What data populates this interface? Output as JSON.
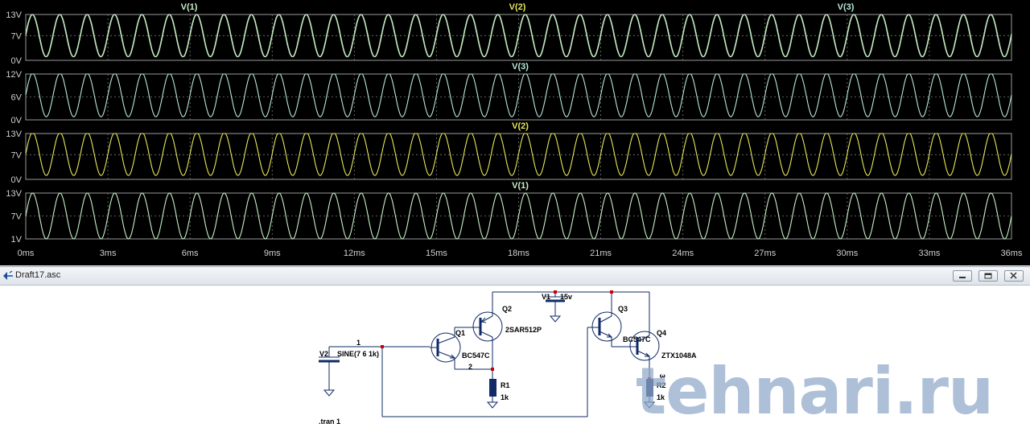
{
  "plot": {
    "panes": [
      {
        "traces": [
          {
            "label": "V(1)",
            "color": "#c8f0c8"
          },
          {
            "label": "V(2)",
            "color": "#e8e85a"
          },
          {
            "label": "V(3)",
            "color": "#b8e8d8"
          }
        ],
        "y_ticks": [
          "13V",
          "7V",
          "0V"
        ],
        "y_range": [
          0,
          13
        ],
        "signal": {
          "offset": 7,
          "amplitude": 6
        }
      },
      {
        "traces": [
          {
            "label": "V(3)",
            "color": "#b8e8d8"
          }
        ],
        "y_ticks": [
          "12V",
          "6V",
          "0V"
        ],
        "y_range": [
          0,
          12
        ],
        "signal": {
          "offset": 6.5,
          "amplitude": 5.7
        }
      },
      {
        "traces": [
          {
            "label": "V(2)",
            "color": "#e8e85a"
          }
        ],
        "y_ticks": [
          "13V",
          "7V",
          "0V"
        ],
        "y_range": [
          0,
          13
        ],
        "signal": {
          "offset": 7.2,
          "amplitude": 6.1
        }
      },
      {
        "traces": [
          {
            "label": "V(1)",
            "color": "#c8f0c8"
          }
        ],
        "y_ticks": [
          "13V",
          "7V",
          "1V"
        ],
        "y_range": [
          1,
          13
        ],
        "signal": {
          "offset": 7,
          "amplitude": 6
        }
      }
    ],
    "x_ticks": [
      "0ms",
      "3ms",
      "6ms",
      "9ms",
      "12ms",
      "15ms",
      "18ms",
      "21ms",
      "24ms",
      "27ms",
      "30ms",
      "33ms",
      "36ms"
    ],
    "x_range_ms": [
      0,
      36
    ],
    "signal_frequency_hz": 1000,
    "grid_color": "#7a7a7a",
    "axis_text_color": "#cfcfcf"
  },
  "schematic_window": {
    "title": "Draft17.asc",
    "icon": "ltspice-schematic-icon",
    "buttons": {
      "minimize": "minimize-icon",
      "restore": "restore-icon",
      "close": "close-icon"
    }
  },
  "schematic": {
    "net_labels": {
      "n1": "1",
      "n2": "2",
      "n3": "3"
    },
    "v2": {
      "name": "V2",
      "value": "SINE(7 6 1k)"
    },
    "v1": {
      "name": "V1",
      "value": "15v"
    },
    "q1": {
      "name": "Q1",
      "model": "BC547C"
    },
    "q2": {
      "name": "Q2",
      "model": "2SAR512P"
    },
    "q3": {
      "name": "Q3",
      "model": "BC547C"
    },
    "q4": {
      "name": "Q4",
      "model": "ZTX1048A"
    },
    "r1": {
      "name": "R1",
      "value": "1k"
    },
    "r2": {
      "name": "R2",
      "value": "1k"
    },
    "directive": ".tran 1"
  },
  "watermark": "tehnari.ru"
}
